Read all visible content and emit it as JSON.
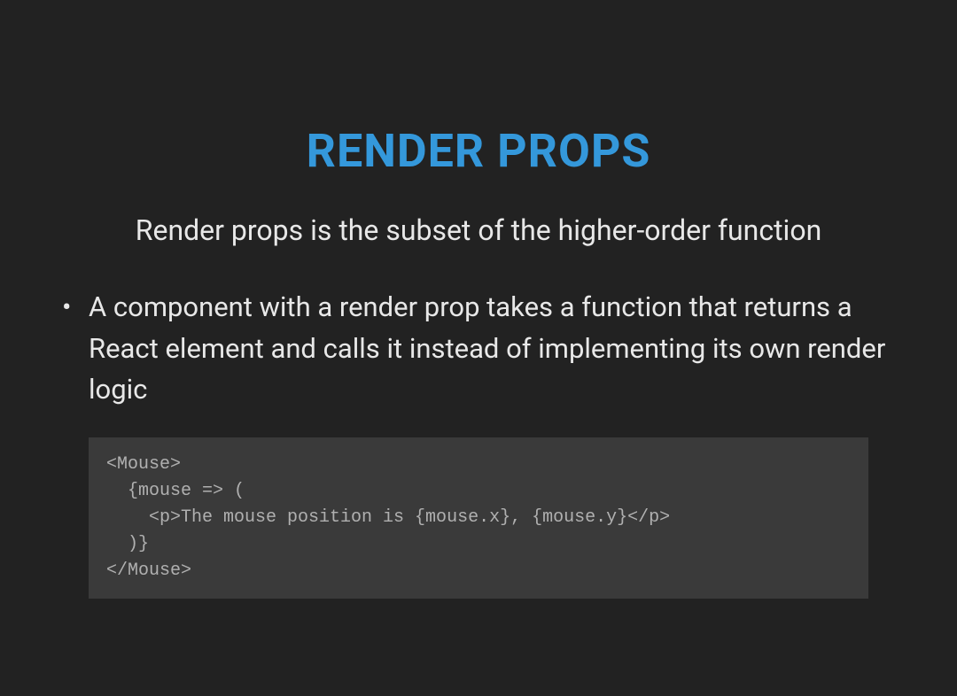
{
  "slide": {
    "title": "RENDER PROPS",
    "subtitle": "Render props is the subset of the higher-order function",
    "bullets": [
      "A component with a render prop takes a function that returns a React element and calls it instead of implementing its own render logic"
    ],
    "code": "<Mouse>\n  {mouse => (\n    <p>The mouse position is {mouse.x}, {mouse.y}</p>\n  )}\n</Mouse>"
  }
}
